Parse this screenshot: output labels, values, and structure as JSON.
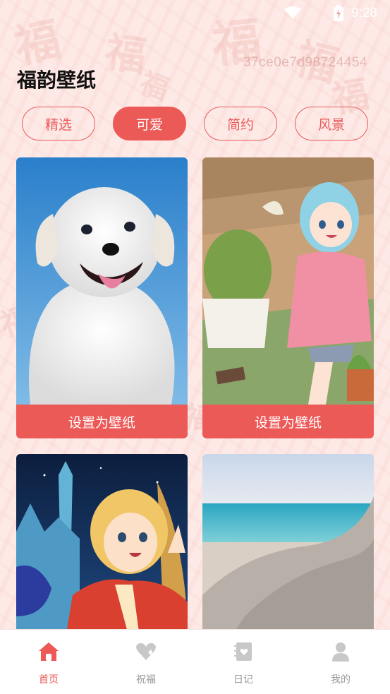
{
  "status_bar": {
    "time": "9:28"
  },
  "watermark": "37ce0e7d98724454",
  "page_title": "福韵壁纸",
  "tabs": [
    {
      "label": "精选",
      "active": false
    },
    {
      "label": "可爱",
      "active": true
    },
    {
      "label": "简约",
      "active": false
    },
    {
      "label": "风景",
      "active": false
    }
  ],
  "wallpapers": [
    {
      "subject": "white puppy on blue sky",
      "set_label": "设置为壁纸"
    },
    {
      "subject": "anime girl with light blue hair in pink sweater",
      "set_label": "设置为壁纸"
    },
    {
      "subject": "blonde anime girl with castle at night"
    },
    {
      "subject": "beach with blurred pillow"
    }
  ],
  "bottom_nav": [
    {
      "label": "首页",
      "icon": "home-icon",
      "active": true
    },
    {
      "label": "祝福",
      "icon": "heart-icon",
      "active": false
    },
    {
      "label": "日记",
      "icon": "diary-icon",
      "active": false
    },
    {
      "label": "我的",
      "icon": "user-icon",
      "active": false
    }
  ],
  "colors": {
    "accent": "#ec5a58",
    "background": "#fde9e6",
    "nav_inactive": "#9a9a9a"
  }
}
